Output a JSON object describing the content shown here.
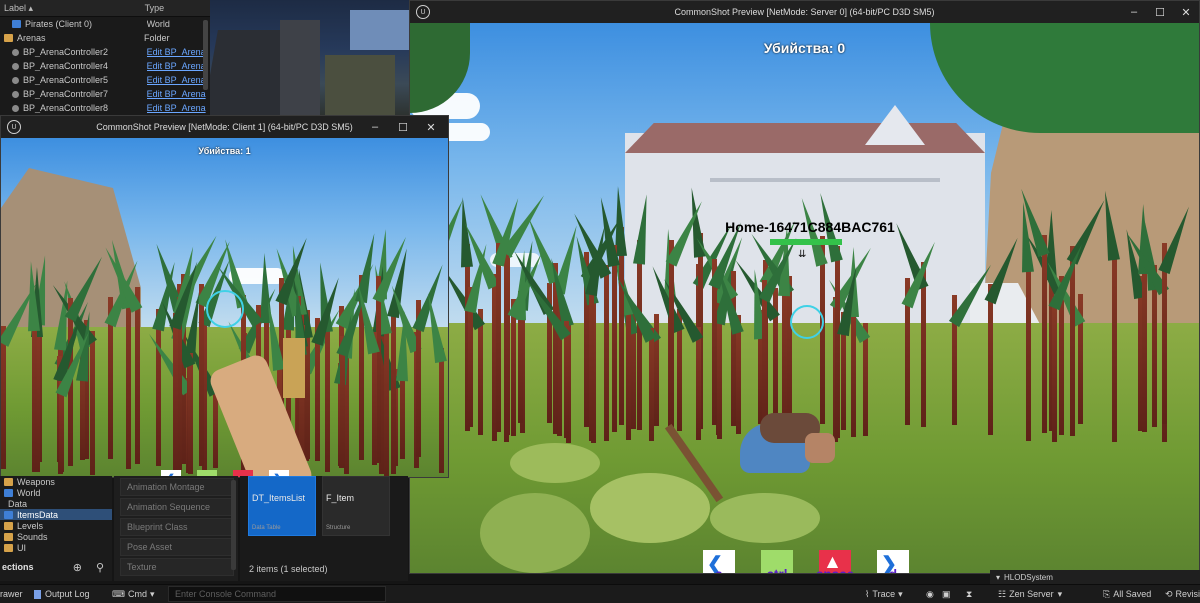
{
  "outliner": {
    "col_label": "Label",
    "col_type": "Type",
    "rows": [
      {
        "label": "Pirates (Client 0)",
        "type": "World",
        "link": false
      },
      {
        "label": "Arenas",
        "type": "Folder",
        "link": false
      },
      {
        "label": "BP_ArenaController2",
        "type": "Edit BP_Arena",
        "link": true
      },
      {
        "label": "BP_ArenaController4",
        "type": "Edit BP_Arena",
        "link": true
      },
      {
        "label": "BP_ArenaController5",
        "type": "Edit BP_Arena",
        "link": true
      },
      {
        "label": "BP_ArenaController7",
        "type": "Edit BP_Arena",
        "link": true
      },
      {
        "label": "BP_ArenaController8",
        "type": "Edit BP_Arena",
        "link": true
      }
    ]
  },
  "server_window": {
    "title": "CommonShot Preview [NetMode: Server 0]  (64-bit/PC D3D SM5)",
    "kills": "Убийства: 0",
    "player_name": "Home-16471C884BAC761",
    "keys": [
      "a",
      "ctrl",
      "space",
      "d"
    ]
  },
  "client_window": {
    "title": "CommonShot Preview [NetMode: Client 1]  (64-bit/PC D3D SM5)",
    "kills": "Убийства: 1",
    "keys": [
      "a",
      "ctrl",
      "space",
      "d"
    ]
  },
  "sources": {
    "items": [
      {
        "label": "Weapons",
        "icon": "folder",
        "selected": false
      },
      {
        "label": "World",
        "icon": "folder-blue",
        "selected": false
      },
      {
        "label": "Data",
        "icon": "none",
        "selected": false
      },
      {
        "label": "ItemsData",
        "icon": "folder-blue",
        "selected": true
      },
      {
        "label": "Levels",
        "icon": "folder",
        "selected": false
      },
      {
        "label": "Sounds",
        "icon": "folder",
        "selected": false
      },
      {
        "label": "UI",
        "icon": "folder",
        "selected": false
      }
    ],
    "footer_label": "ections"
  },
  "filters": [
    "Animation Montage",
    "Animation Sequence",
    "Blueprint Class",
    "Pose Asset",
    "Texture"
  ],
  "assets": {
    "tiles": [
      {
        "name": "DT_ItemsList",
        "type": "Data Table",
        "selected": true
      },
      {
        "name": "F_Item",
        "type": "Structure",
        "selected": false
      }
    ],
    "count": "2 items (1 selected)"
  },
  "right_panel": {
    "label": "HLODSystem"
  },
  "statusbar": {
    "drawer": "rawer",
    "output_log": "Output Log",
    "cmd": "Cmd",
    "console_placeholder": "Enter Console Command",
    "trace": "Trace",
    "zen": "Zen Server",
    "saved": "All Saved",
    "revision": "Revision"
  },
  "colors": {
    "accent": "#1468c8",
    "crosshair": "#3fd1e6",
    "health": "#34c24a",
    "link": "#6aa6ff"
  }
}
